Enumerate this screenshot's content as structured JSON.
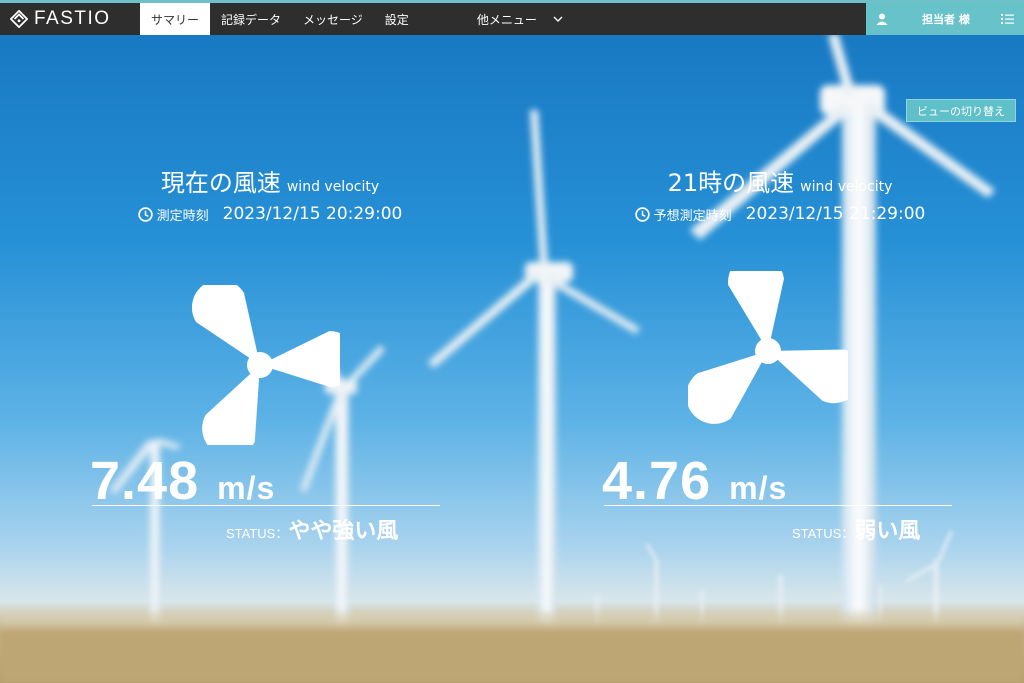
{
  "app": {
    "brand": "FASTIO"
  },
  "nav": {
    "items": [
      {
        "label": "サマリー",
        "active": true
      },
      {
        "label": "記録データ",
        "active": false
      },
      {
        "label": "メッセージ",
        "active": false
      },
      {
        "label": "設定",
        "active": false
      }
    ],
    "other_menu": "他メニュー"
  },
  "user": {
    "name": "担当者 様"
  },
  "view_toggle": "ビューの切り替え",
  "current": {
    "title": "現在の風速",
    "subtitle": "wind velocity",
    "time_label": "測定時刻",
    "time_value": "2023/12/15 20:29:00",
    "speed_value": "7.48",
    "speed_unit": "m/s",
    "status_label": "STATUS：",
    "status_value": "やや強い風"
  },
  "forecast": {
    "title": "21時の風速",
    "subtitle": "wind velocity",
    "time_label": "予想測定時刻",
    "time_value": "2023/12/15 21:29:00",
    "speed_value": "4.76",
    "speed_unit": "m/s",
    "status_label": "STATUS：",
    "status_value": "弱い風"
  },
  "colors": {
    "topbar": "#2e2e2e",
    "accent": "#67c2c9",
    "sky": "#2690d6"
  },
  "icons": {
    "logo": "fastio-logo-icon",
    "user": "user-icon",
    "list": "list-icon",
    "clock": "clock-icon",
    "fan": "wind-turbine-icon"
  }
}
